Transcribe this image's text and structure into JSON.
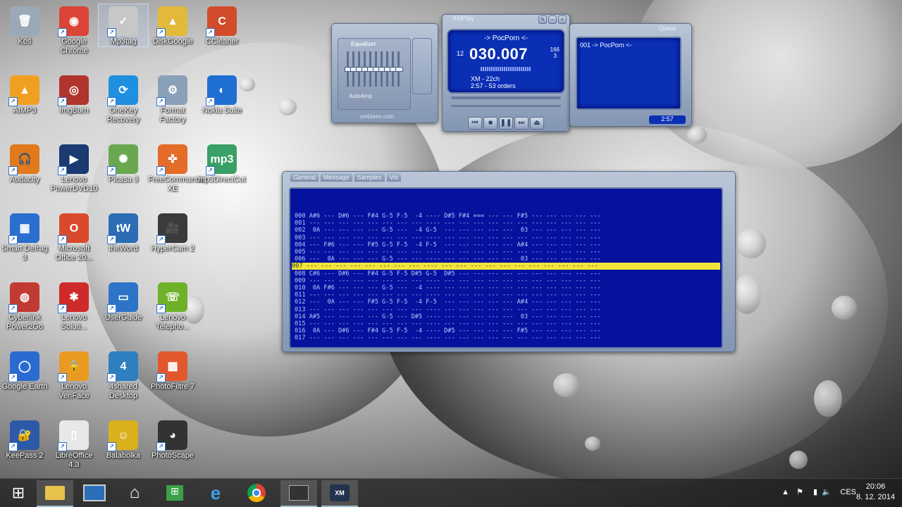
{
  "desktop_icons": [
    {
      "label": "Koš",
      "glyph": "🗑",
      "color": "#9aa8b8"
    },
    {
      "label": "Google Chrome",
      "glyph": "◉",
      "color": "#db4437"
    },
    {
      "label": "Mp3tag",
      "glyph": "✓",
      "color": "#c7c7c7"
    },
    {
      "label": "DiskGoogle",
      "glyph": "▲",
      "color": "#e2b93a"
    },
    {
      "label": "CCleaner",
      "glyph": "C",
      "color": "#d14c2b"
    },
    {
      "label": "AIMP3",
      "glyph": "▲",
      "color": "#f0a020"
    },
    {
      "label": "ImgBurn",
      "glyph": "◎",
      "color": "#b0342c"
    },
    {
      "label": "OneKey Recovery",
      "glyph": "⟳",
      "color": "#1f8fe0"
    },
    {
      "label": "Format Factory",
      "glyph": "⚙",
      "color": "#8aa0b8"
    },
    {
      "label": "Nokia Suite",
      "glyph": "◐",
      "color": "#1e6fd1"
    },
    {
      "label": "Audacity",
      "glyph": "🎧",
      "color": "#e07a1d"
    },
    {
      "label": "Lenovo PowerDVD10",
      "glyph": "▶",
      "color": "#1a3a70"
    },
    {
      "label": "Picasa 3",
      "glyph": "✺",
      "color": "#6aa84f"
    },
    {
      "label": "FreeCommander XE",
      "glyph": "✜",
      "color": "#e46b28"
    },
    {
      "label": "mp3DirectCut",
      "glyph": "mp3",
      "color": "#3aa066"
    },
    {
      "label": "Smart Defrag 3",
      "glyph": "▦",
      "color": "#2a6fd0"
    },
    {
      "label": "Microsoft Office 20...",
      "glyph": "O",
      "color": "#d9492c"
    },
    {
      "label": "theWord",
      "glyph": "tW",
      "color": "#2b6cb5"
    },
    {
      "label": "HyperCam 2",
      "glyph": "🎥",
      "color": "#3b3b3b"
    },
    {
      "label": "",
      "glyph": "",
      "color": "transparent"
    },
    {
      "label": "Cyberlink Power2Go",
      "glyph": "◍",
      "color": "#c23b33"
    },
    {
      "label": "Lenovo Soluti...",
      "glyph": "✱",
      "color": "#cf2a2a"
    },
    {
      "label": "UserGuide",
      "glyph": "▭",
      "color": "#2d74c8"
    },
    {
      "label": "Lenovo Telepho...",
      "glyph": "☏",
      "color": "#6fb22a"
    },
    {
      "label": "",
      "glyph": "",
      "color": "transparent"
    },
    {
      "label": "Google Earth",
      "glyph": "◯",
      "color": "#2a6bd1"
    },
    {
      "label": "Lenovo VeriFace",
      "glyph": "🔒",
      "color": "#e89b20"
    },
    {
      "label": "4shared Desktop",
      "glyph": "4",
      "color": "#2e7fc0"
    },
    {
      "label": "PhotoFiltre 7",
      "glyph": "▩",
      "color": "#e2582d"
    },
    {
      "label": "",
      "glyph": "",
      "color": "transparent"
    },
    {
      "label": "KeePass 2",
      "glyph": "🔐",
      "color": "#2d5aa8"
    },
    {
      "label": "LibreOffice 4.3",
      "glyph": "▯",
      "color": "#e8e8e8"
    },
    {
      "label": "Balabolka",
      "glyph": "☺",
      "color": "#d9b11e"
    },
    {
      "label": "PhotoScape",
      "glyph": "◕",
      "color": "#333"
    }
  ],
  "equalizer": {
    "title": "Equalizer",
    "autoamp": "AutoAmp",
    "brand": "un4seen.com"
  },
  "player": {
    "title": "XMPlay",
    "track": "-> PocPorn <-",
    "time": "030.007",
    "left_num": "12",
    "right_num_top": "166",
    "right_num_bottom": "3",
    "format": "XM - 22ch",
    "duration": "2:57 - 53 orders"
  },
  "queue": {
    "title": "Queue",
    "item": "001 -> PocPorn <-",
    "time": "2:57"
  },
  "tabs": [
    "General",
    "Message",
    "Samples",
    "Vis"
  ],
  "tracker_rows": [
    "000 A#6 --- D#6 --- F#4 G-5 F-5  -4 ---- D#5 F#4 === --- --- F#5 --- --- --- --- ---",
    "001 --- --- --- --- --- --- --- --- ---- --- --- --- --- --- --- --- --- --- --- ---",
    "002  0A --- --- --- --- G-5 ---  -4 G-5  --- --- --- --- ---  03 --- --- --- --- ---",
    "003 --- --- --- --- --- --- --- --- ---- --- --- --- --- --- --- --- --- --- --- ---",
    "004 --- F#6 --- --- F#5 G-5 F-5  -4 F-5  --- --- --- --- --- A#4 --- --- --- --- ---",
    "005 --- --- --- --- --- --- --- --- ---- --- --- --- --- --- --- --- --- --- --- ---",
    "006 ---  0A --- --- --- G-5 --- --- ---- --- --- --- --- ---  03 --- --- --- --- ---",
    "007 --- --- --- --- --- --- --- --- ---- --- --- --- --- --- --- --- --- --- --- ---",
    "008 C#6 --- D#6 --- F#4 G-5 F-5 D#5 G-5  D#5 --- --- --- --- --- --- --- --- --- ---",
    "009 --- --- --- --- --- --- --- --- ---- --- --- --- --- --- --- --- --- --- --- ---",
    "010  0A F#6 --- --- --- G-5 ---  -4 ---- --- --- --- --- --- --- --- --- --- --- ---",
    "011 --- --- --- --- --- --- --- --- ---- --- --- --- --- --- --- --- --- --- --- ---",
    "012 ---  0A --- --- F#5 G-5 F-5  -4 F-5  --- --- --- --- --- A#4 --- --- --- --- ---",
    "013 --- --- --- --- --- --- --- --- ---- --- --- --- --- --- --- --- --- --- --- ---",
    "014 A#5 --- --- --- --- G-5 --- D#5 ---- --- --- --- --- ---  03 --- --- --- --- ---",
    "015 --- --- --- --- --- --- --- --- ---- --- --- --- --- --- --- --- --- --- --- ---",
    "016  0A --- D#6 --- F#4 G-5 F-5  -4 ---- D#5 --- --- --- --- F#5 --- --- --- --- ---",
    "017 --- --- --- --- --- --- --- --- ---- --- --- --- --- --- --- --- --- --- --- ---"
  ],
  "highlight_row": 7,
  "taskbar": {
    "items": [
      "start",
      "explorer",
      "monitor",
      "home",
      "store",
      "ie",
      "chrome",
      "hypercam",
      "xmplay"
    ],
    "language": "CES",
    "time": "20:06",
    "date": "8. 12. 2014"
  }
}
